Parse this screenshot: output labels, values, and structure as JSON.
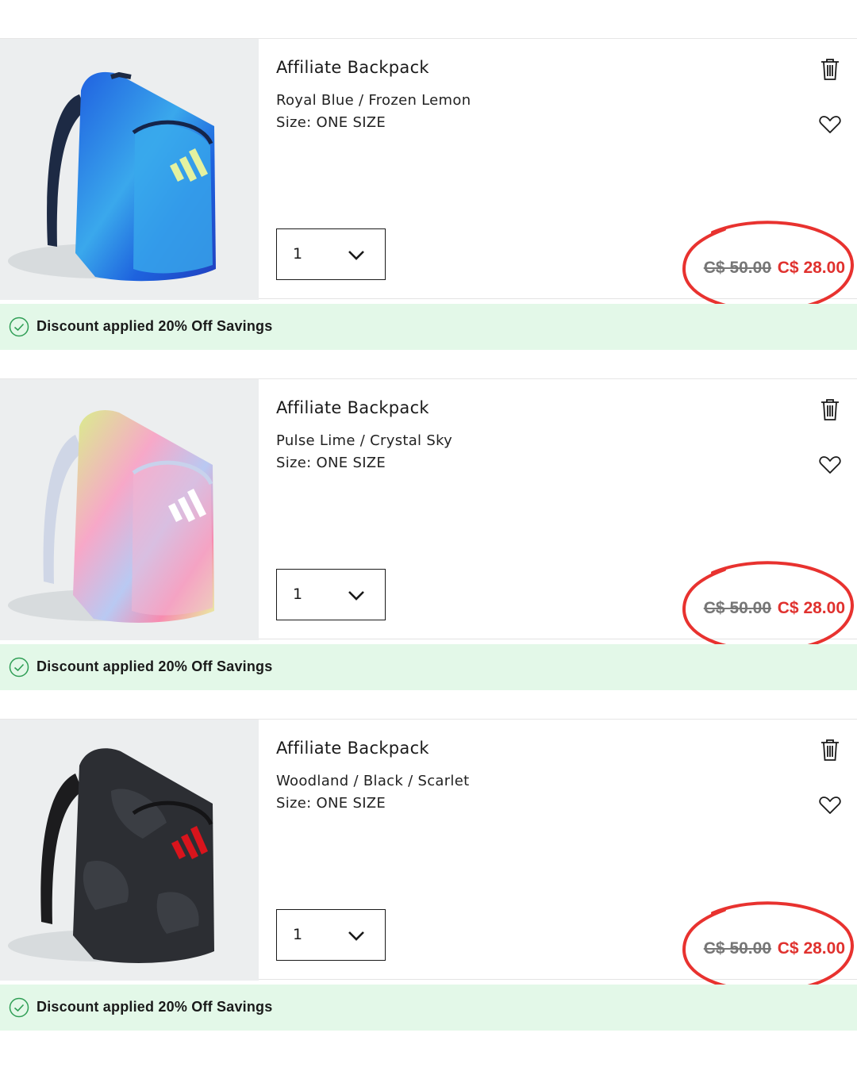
{
  "cart_items": [
    {
      "name": "Affiliate Backpack",
      "color": "Royal Blue / Frozen Lemon",
      "size": "Size: ONE SIZE",
      "quantity": "1",
      "original_price": "C$ 50.00",
      "sale_price": "C$ 28.00",
      "discount_text": "Discount applied 20% Off Savings",
      "image_icon": "backpack-blue-image"
    },
    {
      "name": "Affiliate Backpack",
      "color": "Pulse Lime / Crystal Sky",
      "size": "Size: ONE SIZE",
      "quantity": "1",
      "original_price": "C$ 50.00",
      "sale_price": "C$ 28.00",
      "discount_text": "Discount applied 20% Off Savings",
      "image_icon": "backpack-pastel-image"
    },
    {
      "name": "Affiliate Backpack",
      "color": "Woodland / Black / Scarlet",
      "size": "Size: ONE SIZE",
      "quantity": "1",
      "original_price": "C$ 50.00",
      "sale_price": "C$ 28.00",
      "discount_text": "Discount applied 20% Off Savings",
      "image_icon": "backpack-black-image"
    }
  ],
  "colors": {
    "sale_red": "#e0312e",
    "strike_gray": "#767676",
    "discount_bg": "#e3f8e8",
    "check_green": "#2f9e55",
    "annotation_ring": "#e8322f"
  }
}
